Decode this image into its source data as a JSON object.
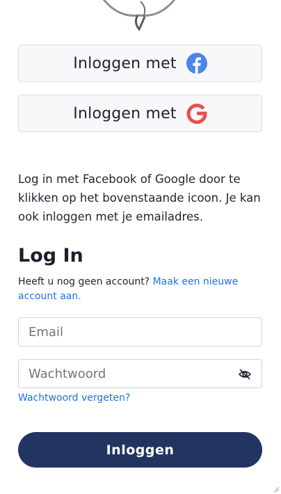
{
  "social": {
    "facebook_label": "Inloggen met",
    "google_label": "Inloggen met"
  },
  "intro": {
    "text": "Log in met Facebook of Google door te klikken op het bovenstaande icoon. Je kan ook inloggen met je emailadres."
  },
  "login": {
    "title": "Log In",
    "no_account_text": "Heeft u nog geen account?",
    "create_account_link": "Maak een nieuwe account aan.",
    "email_placeholder": "Email",
    "password_placeholder": "Wachtwoord",
    "forgot_password_link": "Wachtwoord vergeten?",
    "submit_label": "Inloggen"
  },
  "colors": {
    "brand_dark": "#223561",
    "link": "#1a73e8",
    "facebook": "#4a86e8",
    "google": "#e5504f"
  },
  "icons": {
    "facebook": "facebook-icon",
    "google": "google-icon",
    "password_toggle": "eye-slash-icon"
  }
}
